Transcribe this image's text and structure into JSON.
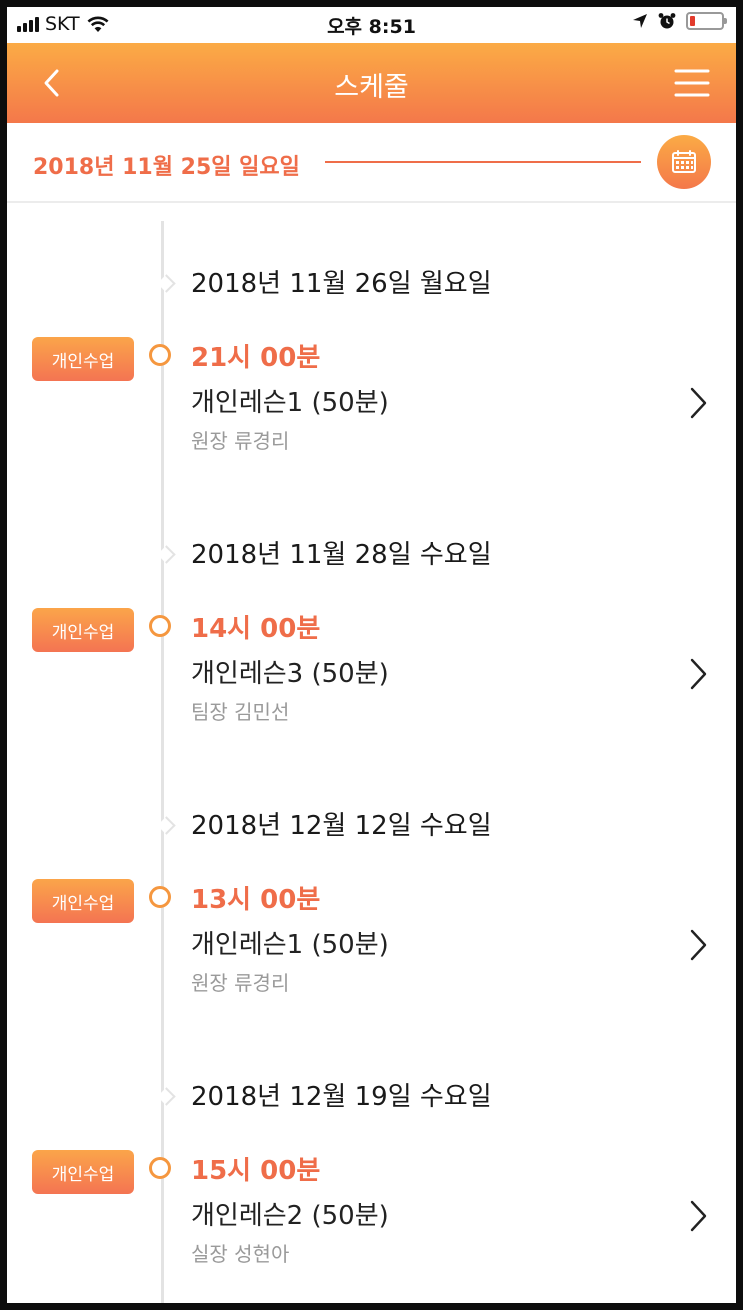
{
  "status_bar": {
    "carrier": "SKT",
    "time": "오후 8:51",
    "battery_level": 0.12,
    "battery_color": "#e23b2c"
  },
  "header": {
    "title": "스케줄",
    "back_icon": "chevron-left-icon",
    "menu_icon": "hamburger-menu-icon"
  },
  "date_bar": {
    "current_date": "2018년 11월 25일 일요일",
    "calendar_icon": "calendar-icon"
  },
  "colors": {
    "accent": "#ef6d49",
    "gradient_top": "#fbab45",
    "gradient_bottom": "#f4784a"
  },
  "schedule": [
    {
      "date": "2018년 11월 26일 월요일",
      "badge": "개인수업",
      "time": "21시 00분",
      "lesson": "개인레슨1 (50분)",
      "instructor": "원장 류경리"
    },
    {
      "date": "2018년 11월 28일 수요일",
      "badge": "개인수업",
      "time": "14시 00분",
      "lesson": "개인레슨3 (50분)",
      "instructor": "팀장 김민선"
    },
    {
      "date": "2018년 12월 12일 수요일",
      "badge": "개인수업",
      "time": "13시 00분",
      "lesson": "개인레슨1 (50분)",
      "instructor": "원장 류경리"
    },
    {
      "date": "2018년 12월 19일 수요일",
      "badge": "개인수업",
      "time": "15시 00분",
      "lesson": "개인레슨2 (50분)",
      "instructor": "실장 성현아"
    }
  ]
}
